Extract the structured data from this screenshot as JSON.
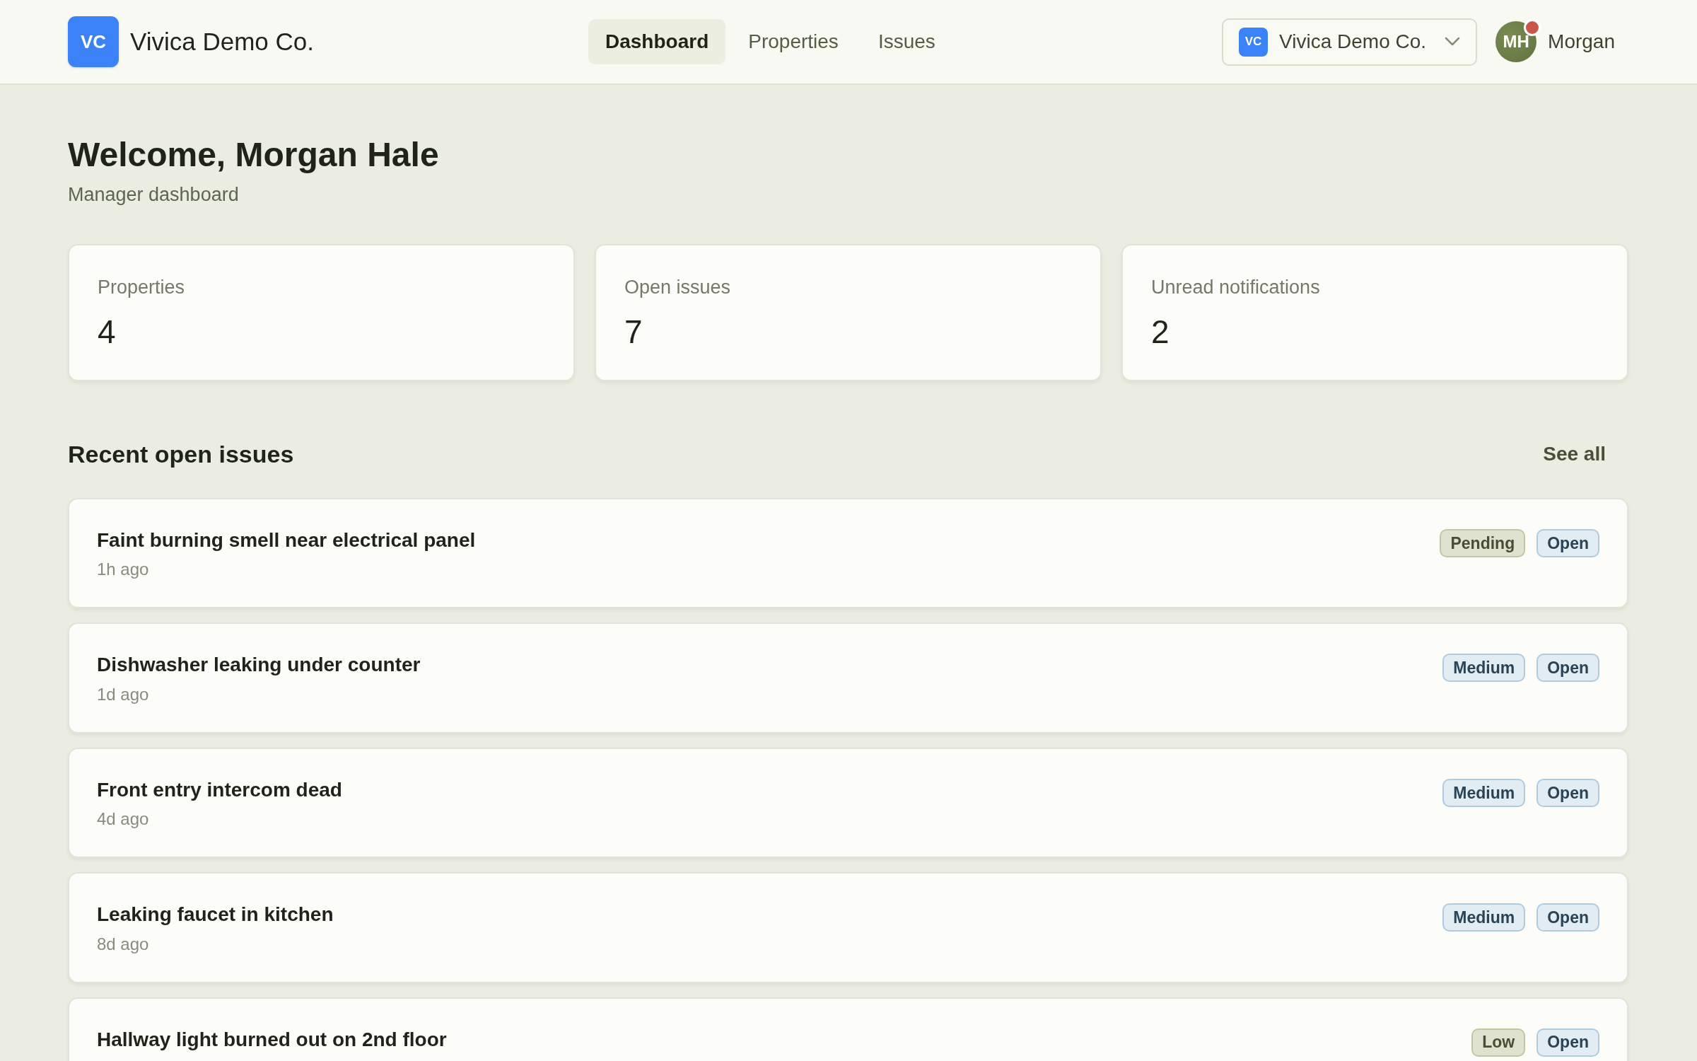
{
  "brand": {
    "initials": "VC",
    "name": "Vivica Demo Co."
  },
  "nav": [
    {
      "label": "Dashboard",
      "selected": true
    },
    {
      "label": "Properties",
      "selected": false
    },
    {
      "label": "Issues",
      "selected": false
    }
  ],
  "org_switcher": {
    "initials": "VC",
    "name": "Vivica Demo Co."
  },
  "user": {
    "initials": "MH",
    "name": "Morgan",
    "has_notification": true
  },
  "page": {
    "title": "Welcome, Morgan Hale",
    "subtitle": "Manager dashboard"
  },
  "stats": [
    {
      "label": "Properties",
      "value": "4"
    },
    {
      "label": "Open issues",
      "value": "7"
    },
    {
      "label": "Unread notifications",
      "value": "2"
    }
  ],
  "section": {
    "title": "Recent open issues",
    "link": "See all"
  },
  "issues": [
    {
      "title": "Faint burning smell near electrical panel",
      "time": "1h ago",
      "tags": [
        {
          "label": "Pending",
          "color": "#dfe2cf"
        },
        {
          "label": "Open",
          "color": "#e2ecf3"
        }
      ]
    },
    {
      "title": "Dishwasher leaking under counter",
      "time": "1d ago",
      "tags": [
        {
          "label": "Medium",
          "color": "#e2ecf3"
        },
        {
          "label": "Open",
          "color": "#e2ecf3"
        }
      ]
    },
    {
      "title": "Front entry intercom dead",
      "time": "4d ago",
      "tags": [
        {
          "label": "Medium",
          "color": "#e2ecf3"
        },
        {
          "label": "Open",
          "color": "#e2ecf3"
        }
      ]
    },
    {
      "title": "Leaking faucet in kitchen",
      "time": "8d ago",
      "tags": [
        {
          "label": "Medium",
          "color": "#e2ecf3"
        },
        {
          "label": "Open",
          "color": "#e2ecf3"
        }
      ]
    },
    {
      "title": "Hallway light burned out on 2nd floor",
      "tags": [
        {
          "label": "Low",
          "color": "#dfe2cf"
        },
        {
          "label": "Open",
          "color": "#e2ecf3"
        }
      ]
    }
  ]
}
